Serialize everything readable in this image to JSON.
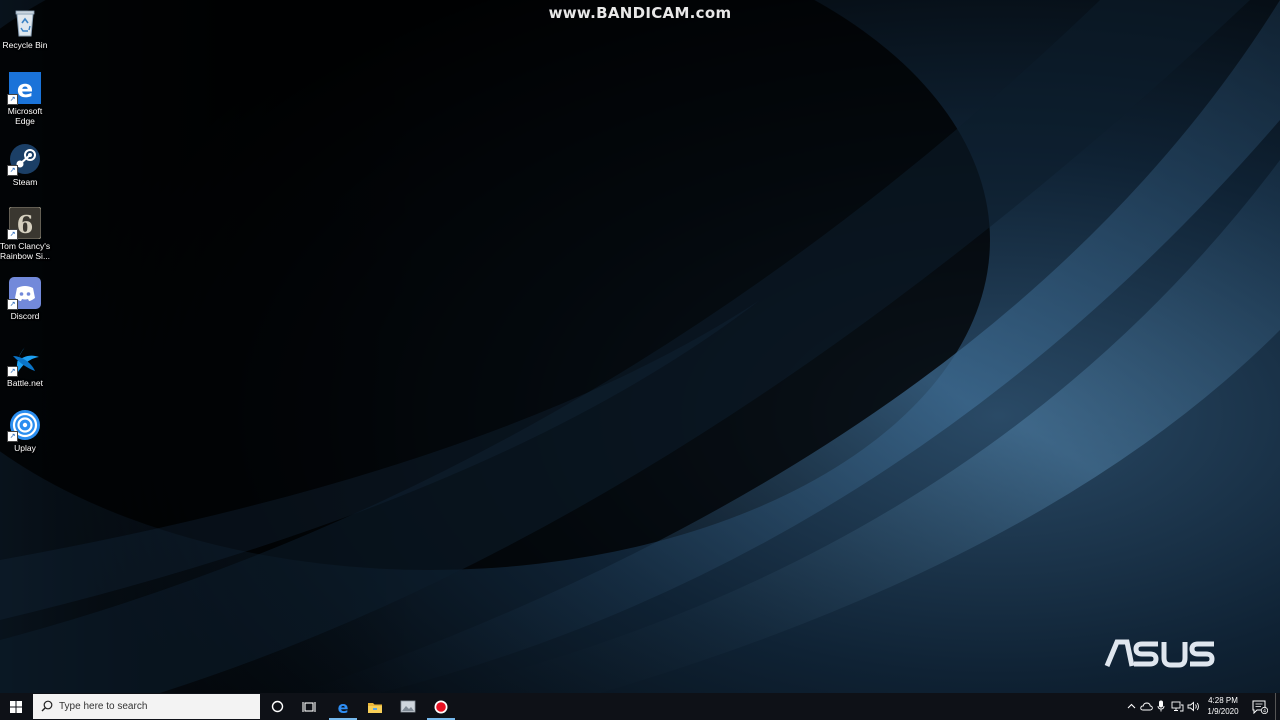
{
  "watermark": {
    "text": "www.BANDICAM.com"
  },
  "brand": {
    "logo_text": "ASUS"
  },
  "desktop_icons": [
    {
      "label": "Recycle Bin",
      "icon": "recycle-bin-icon"
    },
    {
      "label": "Microsoft Edge",
      "icon": "edge-icon"
    },
    {
      "label": "Steam",
      "icon": "steam-icon"
    },
    {
      "label": "Tom Clancy's Rainbow Si...",
      "icon": "rainbow-six-icon"
    },
    {
      "label": "Discord",
      "icon": "discord-icon"
    },
    {
      "label": "Battle.net",
      "icon": "battlenet-icon"
    },
    {
      "label": "Uplay",
      "icon": "uplay-icon"
    }
  ],
  "taskbar": {
    "search_placeholder": "Type here to search",
    "pinned": [
      "cortana-icon",
      "task-view-icon",
      "edge-icon",
      "file-explorer-icon",
      "app-icon",
      "bandicam-record-icon"
    ],
    "clock": {
      "time": "4:28 PM",
      "date": "1/9/2020"
    },
    "tray_icons": [
      "chevron-up-icon",
      "onedrive-icon",
      "microphone-icon",
      "network-icon",
      "volume-icon"
    ],
    "notification_count": "4"
  },
  "colors": {
    "taskbar_bg": "#0e1117",
    "accent": "#76b9ed",
    "record_red": "#e81123"
  }
}
